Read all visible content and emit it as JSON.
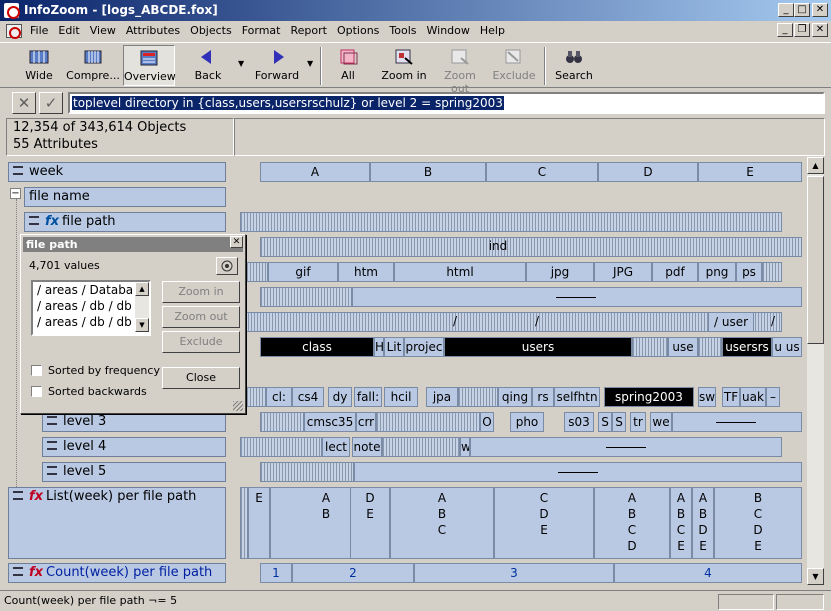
{
  "window": {
    "title": "InfoZoom - [logs_ABCDE.fox]",
    "min": "_",
    "max": "□",
    "close": "✕"
  },
  "menu": [
    "File",
    "Edit",
    "View",
    "Attributes",
    "Objects",
    "Format",
    "Report",
    "Options",
    "Tools",
    "Window",
    "Help"
  ],
  "toolbar": {
    "wide": "Wide",
    "compress": "Compre...",
    "overview": "Overview",
    "back": "Back",
    "forward": "Forward",
    "all": "All",
    "zoom_in": "Zoom in",
    "zoom_out": "Zoom out",
    "exclude": "Exclude",
    "search": "Search"
  },
  "filter": {
    "query": "toplevel directory in {class,users,usersrschulz} or level 2 = spring2003"
  },
  "info": {
    "objects": "12,354 of 343,614 Objects",
    "attributes": "55 Attributes"
  },
  "attributes": {
    "week": "week",
    "file_name": "file name",
    "file_path": "file path",
    "level3": "level 3",
    "level4": "level 4",
    "level5": "level 5",
    "list_week": "List(week) per file path",
    "count_week": "Count(week) per file path"
  },
  "dialog": {
    "title": "file path",
    "values": "4,701 values",
    "items": [
      "/ areas / Databa",
      "/ areas / db / db",
      "/ areas / db / db"
    ],
    "zoom_in": "Zoom in",
    "zoom_out": "Zoom out",
    "exclude": "Exclude",
    "close": "Close",
    "sorted_freq": "Sorted by frequency",
    "sorted_back": "Sorted backwards"
  },
  "week_row": [
    "A",
    "B",
    "C",
    "D",
    "E"
  ],
  "ind": "ind",
  "ext_row": [
    "gif",
    "htm",
    "html",
    "jpg",
    "JPG",
    "pdf",
    "png",
    "ps"
  ],
  "slash_row": {
    "a": "/",
    "b": "/",
    "c": "/ user",
    "d": "/"
  },
  "toplevel_row": {
    "class": "class",
    "h": "H",
    "lit": "Lit",
    "projec": "projec",
    "users": "users",
    "use": "use",
    "usersrs": "usersrs",
    "uus": "u us"
  },
  "level2_row": [
    "cl:",
    "cs4",
    "dy",
    "fall:",
    "hcil",
    "jpa",
    "qing",
    "rs",
    "selfhtn",
    "spring2003",
    "sw",
    "TF",
    "uak",
    "–"
  ],
  "level3_row": [
    "cmsc35",
    "crr",
    "O",
    "pho",
    "s03",
    "S",
    "S",
    "tr",
    "we"
  ],
  "level4_row": [
    "lect",
    "note",
    "w"
  ],
  "list_row": {
    "e": "E",
    "cols": [
      [
        "A",
        "B"
      ],
      [
        "D",
        "E"
      ],
      [
        "A",
        "B",
        "C"
      ],
      [
        "C",
        "D",
        "E"
      ],
      [
        "A",
        "B",
        "C",
        "D"
      ],
      [
        "A",
        "B",
        "C",
        "E"
      ],
      [
        "A",
        "B",
        "D",
        "E"
      ],
      [
        "B",
        "C",
        "D",
        "E"
      ]
    ]
  },
  "count_row": [
    "1",
    "2",
    "3",
    "4"
  ],
  "status": {
    "text": "Count(week) per file path ¬= 5"
  },
  "colors": {
    "attr_fill": "#b9c9e3",
    "title_start": "#0a246a",
    "title_end": "#a6caf0"
  }
}
